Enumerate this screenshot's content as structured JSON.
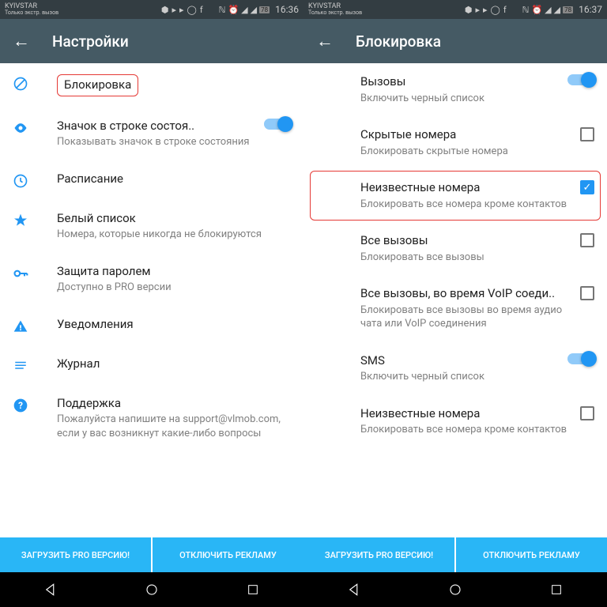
{
  "status": {
    "carrier": "KYIVSTAR",
    "sub": "Только экстр. вызов",
    "battery": "78",
    "time_left": "16:36",
    "time_right": "16:37"
  },
  "left": {
    "title": "Настройки",
    "items": [
      {
        "title": "Блокировка",
        "sub": ""
      },
      {
        "title": "Значок в строке состоя..",
        "sub": "Показывать значок в строке состояния"
      },
      {
        "title": "Расписание",
        "sub": ""
      },
      {
        "title": "Белый список",
        "sub": "Номера, которые никогда не блокируются"
      },
      {
        "title": "Защита паролем",
        "sub": "Доступно в PRO версии"
      },
      {
        "title": "Уведомления",
        "sub": ""
      },
      {
        "title": "Журнал",
        "sub": ""
      },
      {
        "title": "Поддержка",
        "sub": "Пожалуйста напишите на support@vlmob.com, если у вас возникнут какие-либо вопросы"
      }
    ]
  },
  "right": {
    "title": "Блокировка",
    "items": [
      {
        "title": "Вызовы",
        "sub": "Включить черный список"
      },
      {
        "title": "Скрытые номера",
        "sub": "Блокировать скрытые номера"
      },
      {
        "title": "Неизвестные номера",
        "sub": "Блокировать все номера кроме контактов"
      },
      {
        "title": "Все вызовы",
        "sub": "Блокировать все вызовы"
      },
      {
        "title": "Все вызовы, во время VoIP соеди..",
        "sub": "Блокировать все вызовы во время аудио чата или VoIP соединения"
      },
      {
        "title": "SMS",
        "sub": "Включить черный список"
      },
      {
        "title": "Неизвестные номера",
        "sub": "Блокировать все номера кроме контактов"
      }
    ]
  },
  "buttons": {
    "pro": "ЗАГРУЗИТЬ PRO ВЕРСИЮ!",
    "ads": "ОТКЛЮЧИТЬ РЕКЛАМУ"
  }
}
